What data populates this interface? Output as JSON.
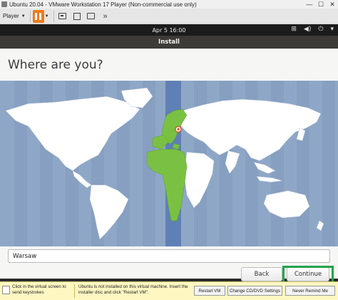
{
  "vmware": {
    "window_title": "Ubuntu 20.04 - VMware Workstation 17 Player (Non-commercial use only)",
    "minimize": "—",
    "maximize": "☐",
    "close": "✕",
    "player_menu": "Player",
    "caret": "▼"
  },
  "gnome": {
    "clock": "Apr 5  16:00",
    "tray_network": "⊞",
    "tray_sound": "◀)",
    "tray_power": "⏻",
    "tray_menu": "▾"
  },
  "installer": {
    "header": "Install",
    "page_title": "Where are you?",
    "timezone_value": "Warsaw",
    "back_label": "Back",
    "continue_label": "Continue",
    "selected_timezone_color": "#7ac143",
    "map_sea_color": "#8fa7c7",
    "map_land_color": "#ffffff",
    "highlight_color": "#23a44a"
  },
  "notice": {
    "left_text": "Click in the virtual screen to send keystrokes",
    "mid_text": "Ubuntu is not installed on this virtual machine. Insert the installer disc and click \"Restart VM\".",
    "restart_label": "Restart VM",
    "change_label": "Change CD/DVD Settings",
    "never_label": "Never Remind Me"
  }
}
